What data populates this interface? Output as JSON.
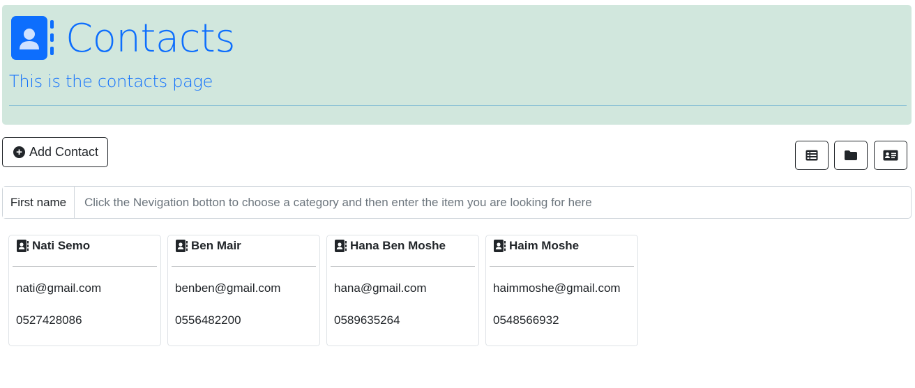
{
  "header": {
    "title": "Contacts",
    "subtitle": "This is the contacts page",
    "accent_color": "#0d6efd",
    "background_color": "#d1e7dd"
  },
  "toolbar": {
    "add_contact_label": "Add Contact",
    "view_buttons": [
      {
        "name": "table-view",
        "icon": "table-list-icon"
      },
      {
        "name": "folder-view",
        "icon": "folder-icon"
      },
      {
        "name": "card-view",
        "icon": "address-card-icon"
      }
    ]
  },
  "search": {
    "category_label": "First name",
    "placeholder": "Click the Nevigation botton to choose a category and then enter the item you are looking for here",
    "value": ""
  },
  "contacts": [
    {
      "name": "Nati Semo",
      "email": "nati@gmail.com",
      "phone": "0527428086",
      "icon": "address-book-icon"
    },
    {
      "name": "Ben Mair",
      "email": "benben@gmail.com",
      "phone": "0556482200",
      "icon": "address-book-icon"
    },
    {
      "name": "Hana Ben Moshe",
      "email": "hana@gmail.com",
      "phone": "0589635264",
      "icon": "address-book-icon"
    },
    {
      "name": "Haim Moshe",
      "email": "haimmoshe@gmail.com",
      "phone": "0548566932",
      "icon": "address-book-icon"
    }
  ]
}
